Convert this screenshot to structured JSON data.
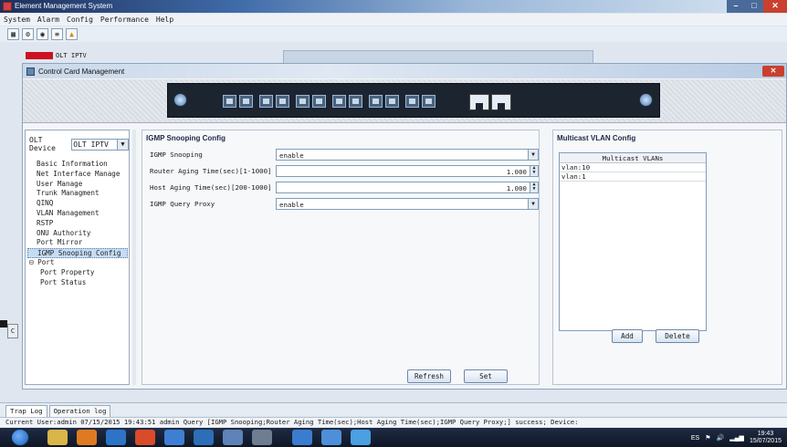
{
  "window": {
    "title": "Element Management System"
  },
  "window_buttons": {
    "minimize": "–",
    "maximize": "□",
    "close": "✕"
  },
  "menu": [
    "System",
    "Alarm",
    "Config",
    "Performance",
    "Help"
  ],
  "toolbar_icons": [
    "topology-icon",
    "tree-icon",
    "alarm-status-icon",
    "list-icon",
    "warning-icon"
  ],
  "background_tree": {
    "label": "OLT IPTV"
  },
  "dialog": {
    "title": "Control Card Management",
    "close": "✕"
  },
  "left_panel": {
    "device_label": "OLT Device",
    "device_value": "OLT IPTV",
    "nav": [
      {
        "label": "Basic Information",
        "type": "item"
      },
      {
        "label": "Net Interface Manage",
        "type": "item"
      },
      {
        "label": "User Manage",
        "type": "item"
      },
      {
        "label": "Trunk Managment",
        "type": "item"
      },
      {
        "label": "QINQ",
        "type": "item"
      },
      {
        "label": "VLAN Management",
        "type": "item"
      },
      {
        "label": "RSTP",
        "type": "item"
      },
      {
        "label": "ONU Authority",
        "type": "item"
      },
      {
        "label": "Port Mirror",
        "type": "item"
      },
      {
        "label": "IGMP Snooping Config",
        "type": "item",
        "selected": true
      },
      {
        "label": "Port",
        "type": "group"
      },
      {
        "label": "Port Property",
        "type": "child"
      },
      {
        "label": "Port Status",
        "type": "child"
      }
    ]
  },
  "igmp": {
    "title": "IGMP Snooping Config",
    "fields": [
      {
        "label": "IGMP Snooping",
        "value": "enable",
        "kind": "dropdown"
      },
      {
        "label": "Router Aging Time(sec)[1-1000]",
        "value": "1.000",
        "kind": "spinner"
      },
      {
        "label": "Host Aging Time(sec)[200-1000]",
        "value": "1.000",
        "kind": "spinner"
      },
      {
        "label": "IGMP Query Proxy",
        "value": "enable",
        "kind": "dropdown"
      }
    ],
    "refresh_label": "Refresh",
    "set_label": "Set"
  },
  "multicast_vlan": {
    "title": "Multicast VLAN Config",
    "column_header": "Multicast VLANs",
    "rows": [
      "vlan:10",
      "vlan:1"
    ],
    "add_label": "Add",
    "delete_label": "Delete"
  },
  "log_tabs": [
    "Trap Log",
    "Operation log"
  ],
  "status_line": "Current User:admin   07/15/2015 19:43:51  admin  Query [IGMP Snooping;Router Aging Time(sec);Host Aging Time(sec);IGMP Query Proxy;] success; Device:",
  "taskbar": {
    "language": "ES",
    "time": "19:43",
    "date": "15/07/2015"
  },
  "colors": {
    "title_gradient_start": "#1d2f5c",
    "selection": "#c6dcf5",
    "close_red": "#c9402f"
  }
}
